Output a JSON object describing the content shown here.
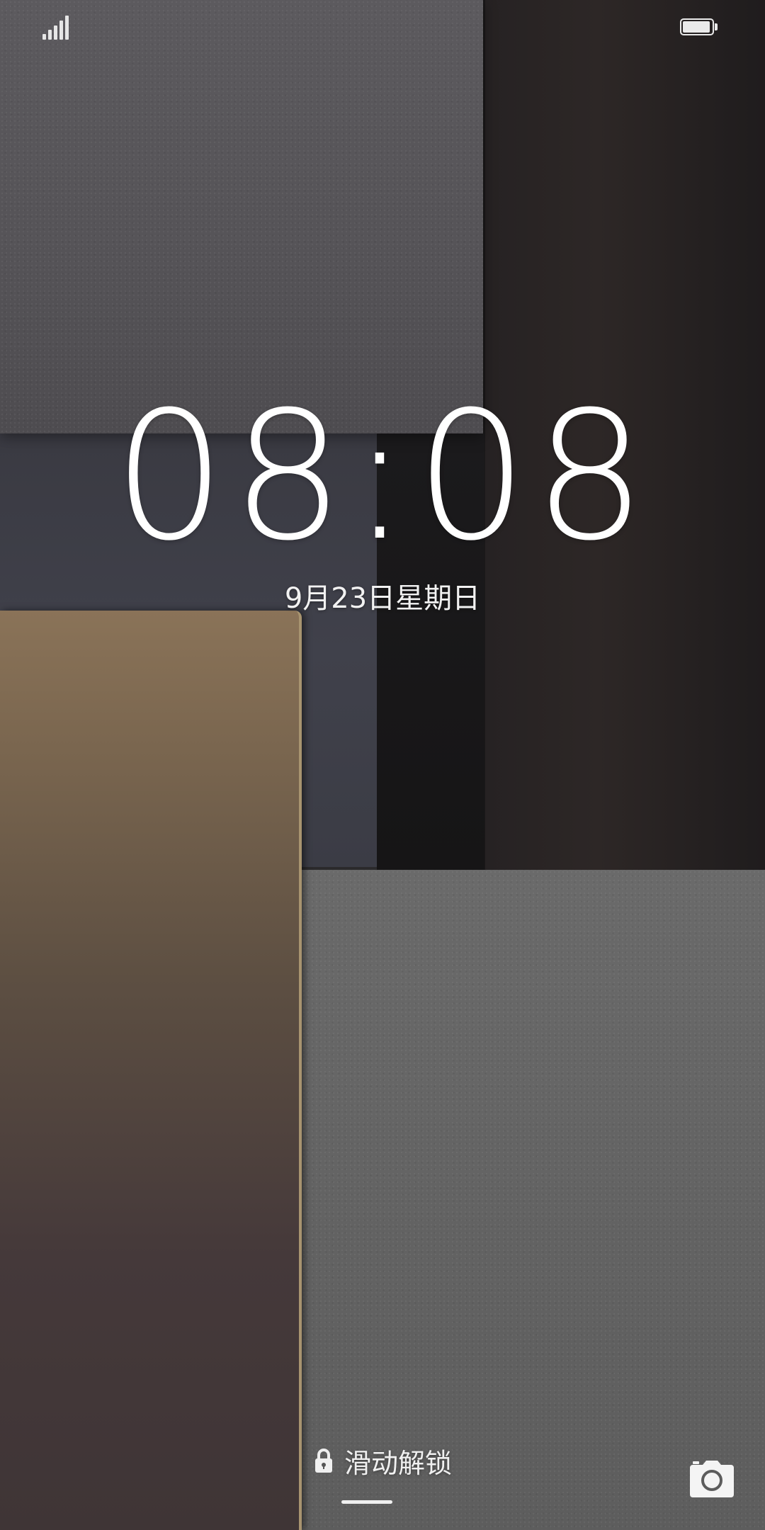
{
  "status_bar": {
    "signal_icon": "signal-strength-icon",
    "battery_icon": "battery-full-icon"
  },
  "lockscreen": {
    "time": "08:08",
    "date": "9月23日星期日",
    "unlock_hint": "滑动解锁",
    "lock_icon": "lock-icon",
    "camera_icon": "camera-icon"
  },
  "colors": {
    "text": "#ffffff",
    "panel_top_left": "#5a585c",
    "panel_right": "#2a2424",
    "panel_gold": "#8a7358",
    "panel_bottom_gray": "#646464"
  }
}
